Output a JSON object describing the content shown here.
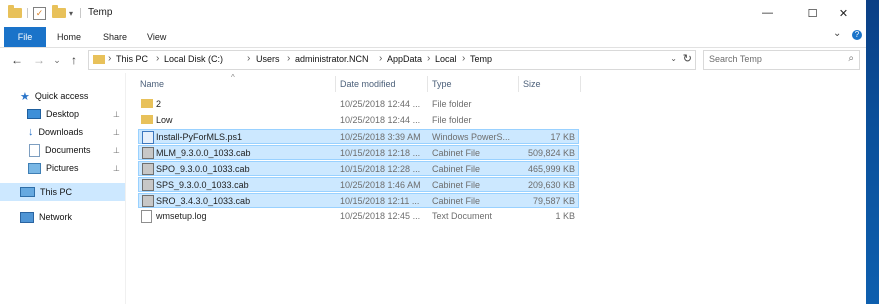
{
  "window": {
    "title": "Temp",
    "controls": {
      "minimize": "—",
      "maximize": "☐",
      "close": "✕"
    }
  },
  "ribbon": {
    "tabs": [
      {
        "label": "File",
        "active": true
      },
      {
        "label": "Home"
      },
      {
        "label": "Share"
      },
      {
        "label": "View"
      }
    ],
    "collapse_glyph": "⌄",
    "help_glyph": "?"
  },
  "navigation": {
    "back": "←",
    "forward": "→",
    "recent": "⌄",
    "up": "↑",
    "breadcrumbs": [
      "This PC",
      "Local Disk (C:)",
      "Users",
      "administrator.NCN",
      "AppData",
      "Local",
      "Temp"
    ],
    "chevron": "›",
    "refresh": "↻",
    "search_placeholder": "Search Temp",
    "search_icon": "⌕"
  },
  "nav_pane": {
    "items": [
      {
        "label": "Quick access",
        "icon": "star-icon"
      },
      {
        "label": "Desktop",
        "icon": "desktop-icon",
        "pinned": true
      },
      {
        "label": "Downloads",
        "icon": "download-icon",
        "pinned": true
      },
      {
        "label": "Documents",
        "icon": "documents-icon",
        "pinned": true
      },
      {
        "label": "Pictures",
        "icon": "pictures-icon",
        "pinned": true
      },
      {
        "label": "This PC",
        "icon": "computer-icon",
        "selected": true
      },
      {
        "label": "Network",
        "icon": "network-icon"
      }
    ],
    "pin_glyph": "📌"
  },
  "file_list": {
    "columns": [
      "Name",
      "Date modified",
      "Type",
      "Size"
    ],
    "sort_caret": "^",
    "rows": [
      {
        "name": "2",
        "date": "10/25/2018 12:44 ...",
        "type": "File folder",
        "size": "",
        "icon": "folder",
        "selected": false
      },
      {
        "name": "Low",
        "date": "10/25/2018 12:44 ...",
        "type": "File folder",
        "size": "",
        "icon": "folder",
        "selected": false
      },
      {
        "name": "Install-PyForMLS.ps1",
        "date": "10/25/2018 3:39 AM",
        "type": "Windows PowerS...",
        "size": "17 KB",
        "icon": "powershell",
        "selected": true
      },
      {
        "name": "MLM_9.3.0.0_1033.cab",
        "date": "10/15/2018 12:18 ...",
        "type": "Cabinet File",
        "size": "509,824 KB",
        "icon": "cab",
        "selected": true
      },
      {
        "name": "SPO_9.3.0.0_1033.cab",
        "date": "10/15/2018 12:28 ...",
        "type": "Cabinet File",
        "size": "465,999 KB",
        "icon": "cab",
        "selected": true
      },
      {
        "name": "SPS_9.3.0.0_1033.cab",
        "date": "10/25/2018 1:46 AM",
        "type": "Cabinet File",
        "size": "209,630 KB",
        "icon": "cab",
        "selected": true
      },
      {
        "name": "SRO_3.4.3.0_1033.cab",
        "date": "10/15/2018 12:11 ...",
        "type": "Cabinet File",
        "size": "79,587 KB",
        "icon": "cab",
        "selected": true
      },
      {
        "name": "wmsetup.log",
        "date": "10/25/2018 12:45 ...",
        "type": "Text Document",
        "size": "1 KB",
        "icon": "text",
        "selected": false
      }
    ]
  },
  "colors": {
    "accent": "#1a73c9",
    "selection": "#cce8ff",
    "selection_border": "#99d1ff",
    "desktop": "#0a4f9a"
  }
}
